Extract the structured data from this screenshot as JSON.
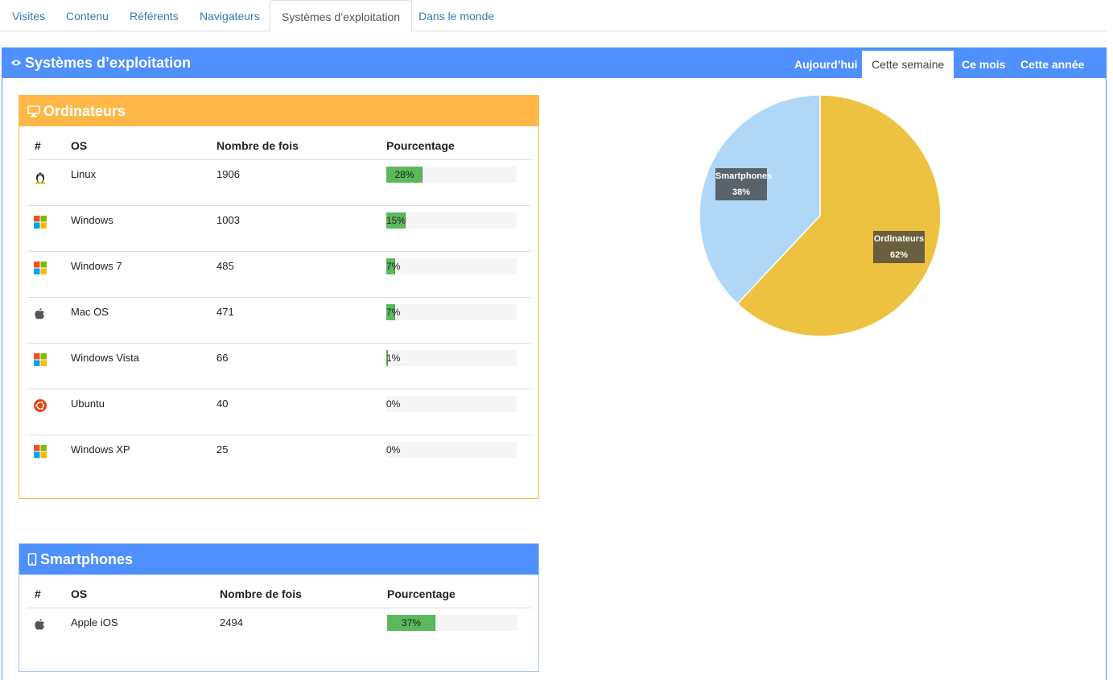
{
  "tabs": [
    {
      "label": "Visites",
      "active": false
    },
    {
      "label": "Contenu",
      "active": false
    },
    {
      "label": "Référents",
      "active": false
    },
    {
      "label": "Navigateurs",
      "active": false
    },
    {
      "label": "Systèmes d’exploitation",
      "active": true
    },
    {
      "label": "Dans le monde",
      "active": false
    }
  ],
  "main": {
    "title": "Systèmes d’exploitation",
    "title_icon": "eye-icon",
    "periods": [
      {
        "label": "Aujourd’hui",
        "active": false
      },
      {
        "label": "Cette semaine",
        "active": true
      },
      {
        "label": "Ce mois",
        "active": false
      },
      {
        "label": "Cette année",
        "active": false
      }
    ]
  },
  "computers": {
    "title": "Ordinateurs",
    "title_icon": "desktop-icon",
    "header_color": "#ffb848",
    "border_color": "#ffb848",
    "columns": [
      "#",
      "OS",
      "Nombre de fois",
      "Pourcentage"
    ],
    "rows": [
      {
        "icon": "linux-icon",
        "os": "Linux",
        "count": "1906",
        "percent_label": "28%",
        "percent": 28
      },
      {
        "icon": "windows-icon",
        "os": "Windows",
        "count": "1003",
        "percent_label": "15%",
        "percent": 15
      },
      {
        "icon": "windows-icon",
        "os": "Windows 7",
        "count": "485",
        "percent_label": "7%",
        "percent": 7
      },
      {
        "icon": "apple-icon",
        "os": "Mac OS",
        "count": "471",
        "percent_label": "7%",
        "percent": 7
      },
      {
        "icon": "windows-icon",
        "os": "Windows Vista",
        "count": "66",
        "percent_label": "1%",
        "percent": 1
      },
      {
        "icon": "ubuntu-icon",
        "os": "Ubuntu",
        "count": "40",
        "percent_label": "0%",
        "percent": 0
      },
      {
        "icon": "windows-icon",
        "os": "Windows XP",
        "count": "25",
        "percent_label": "0%",
        "percent": 0
      }
    ]
  },
  "smartphones": {
    "title": "Smartphones",
    "title_icon": "mobile-icon",
    "header_color": "#4d90fe",
    "border_color": "#a9c6ee",
    "columns": [
      "#",
      "OS",
      "Nombre de fois",
      "Pourcentage"
    ],
    "rows": [
      {
        "icon": "apple-icon",
        "os": "Apple iOS",
        "count": "2494",
        "percent_label": "37%",
        "percent": 37
      }
    ]
  },
  "chart_data": {
    "type": "pie",
    "slices": [
      {
        "label": "Ordinateurs",
        "value_label": "62%",
        "value": 62,
        "color": "#edc240"
      },
      {
        "label": "Smartphones",
        "value_label": "38%",
        "value": 38,
        "color": "#afd8f8"
      }
    ]
  },
  "colors": {
    "accent": "#4d90fe",
    "bar": "#5cb85c",
    "link": "#337ab7"
  }
}
